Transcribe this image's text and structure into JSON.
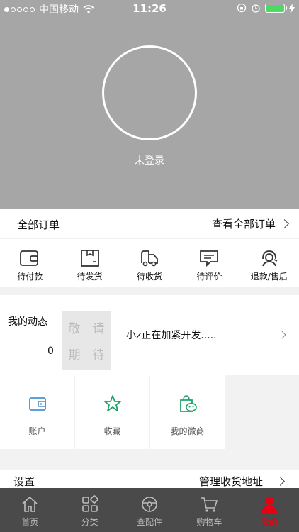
{
  "status": {
    "carrier": "中国移动",
    "time": "11:26"
  },
  "profile": {
    "login_label": "未登录"
  },
  "orders": {
    "title": "全部订单",
    "view_all": "查看全部订单",
    "items": [
      {
        "label": "待付款",
        "icon": "wallet-icon"
      },
      {
        "label": "待发货",
        "icon": "box-icon"
      },
      {
        "label": "待收货",
        "icon": "truck-icon"
      },
      {
        "label": "待评价",
        "icon": "comment-icon"
      },
      {
        "label": "退款/售后",
        "icon": "service-icon"
      }
    ]
  },
  "dynamics": {
    "title": "我的动态",
    "count": "0",
    "placeholder_chars": [
      "敬",
      "请",
      "期",
      "待"
    ],
    "message": "小z正在加紧开发....."
  },
  "quick": {
    "items": [
      {
        "label": "账户",
        "icon": "account-wallet-icon"
      },
      {
        "label": "收藏",
        "icon": "star-icon"
      },
      {
        "label": "我的微商",
        "icon": "wechat-bag-icon"
      }
    ]
  },
  "settings": {
    "title": "设置",
    "address": "管理收货地址"
  },
  "tabbar": {
    "items": [
      {
        "label": "首页",
        "icon": "home-icon"
      },
      {
        "label": "分类",
        "icon": "category-icon"
      },
      {
        "label": "查配件",
        "icon": "parts-icon"
      },
      {
        "label": "购物车",
        "icon": "cart-icon"
      },
      {
        "label": "我的",
        "icon": "user-icon",
        "active": true
      }
    ]
  },
  "colors": {
    "header_bg": "#a6a6a6",
    "tabbar_bg": "#4a4a4a",
    "active": "#e60012",
    "accent_green": "#1fa568",
    "accent_blue": "#4a90d9"
  }
}
